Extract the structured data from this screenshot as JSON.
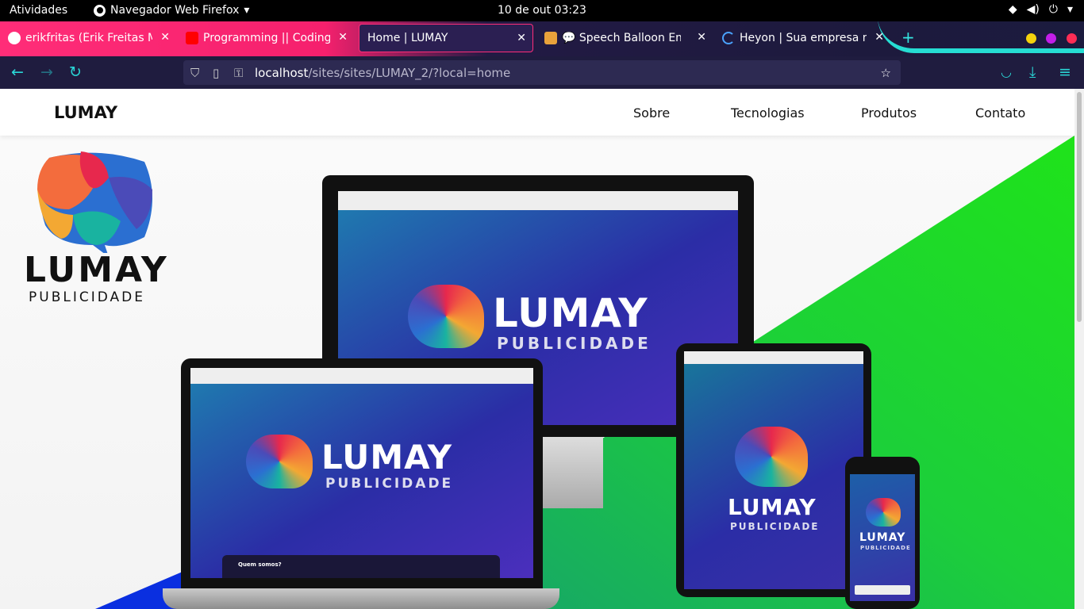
{
  "system": {
    "activities": "Atividades",
    "app_name": "Navegador Web Firefox",
    "clock": "10 de out  03:23"
  },
  "tabs": [
    {
      "title": "erikfritas (Érik Freitas Mo",
      "icon": "github-icon",
      "color": "#ffffff"
    },
    {
      "title": "Programming || Coding || ",
      "icon": "youtube-icon",
      "color": "#ff0000"
    },
    {
      "title": "Home | LUMAY",
      "icon": "none",
      "color": "#ffffff"
    },
    {
      "title": "💬 Speech Balloon Emoji",
      "icon": "emojipedia-icon",
      "color": "#e9a23b"
    },
    {
      "title": "Heyon | Sua empresa no ",
      "icon": "loading-icon",
      "color": "#4aa3ff"
    }
  ],
  "url": {
    "host": "localhost",
    "path": "/sites/sites/LUMAY_2/?local=home"
  },
  "site": {
    "brand": "LUMAY",
    "nav": [
      "Sobre",
      "Tecnologias",
      "Produtos",
      "Contato"
    ],
    "logo_word": "LUMAY",
    "logo_sub": "PUBLICIDADE"
  },
  "mockup": {
    "laptop_caption": "Quem somos?"
  },
  "colors": {
    "accent": "#ff2d78",
    "teal": "#27e8dc",
    "green": "#1fe31a",
    "navy": "#1f1c3f"
  }
}
